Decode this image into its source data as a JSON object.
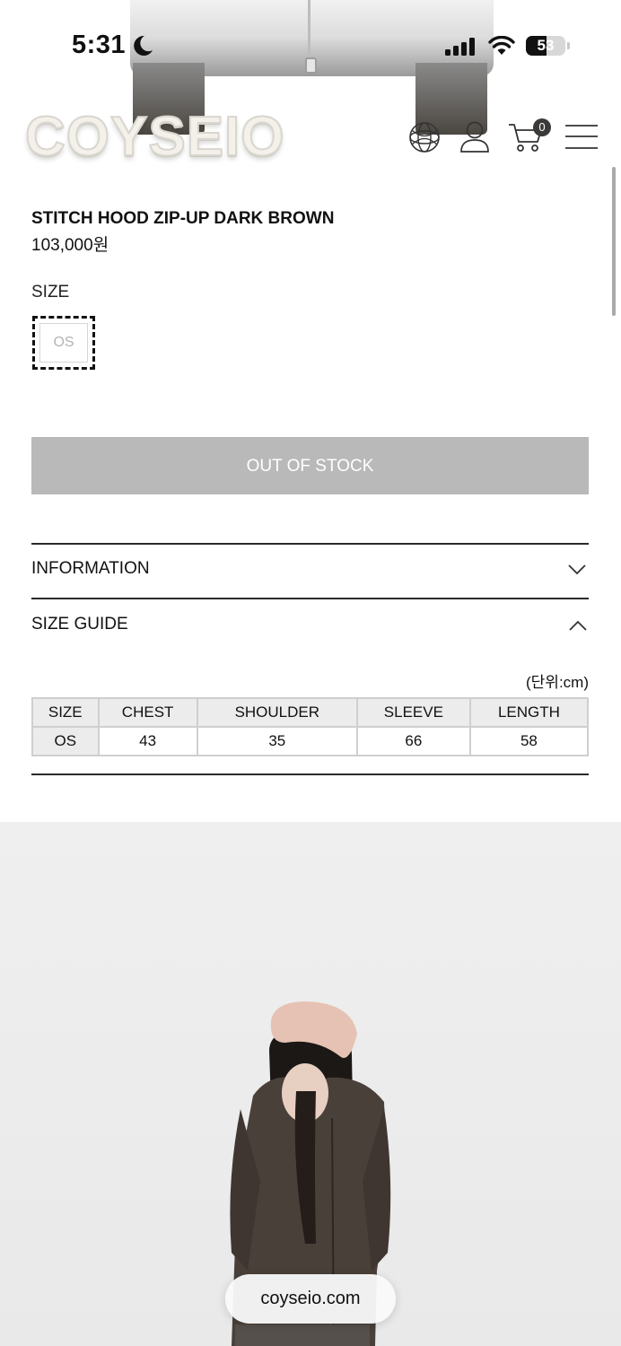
{
  "status_bar": {
    "time": "5:31",
    "battery": "53",
    "battery_level": 0.53,
    "icons": [
      "moon-icon",
      "signal-icon",
      "wifi-icon",
      "battery-icon"
    ]
  },
  "header": {
    "logo": "COYSEIO",
    "cart_count": "0",
    "icons": [
      "globe-icon",
      "user-icon",
      "cart-icon",
      "menu-icon"
    ]
  },
  "product": {
    "name": "STITCH HOOD ZIP-UP DARK BROWN",
    "price": "103,000원",
    "size_label": "SIZE",
    "size_options": [
      "OS"
    ],
    "button_label": "OUT OF STOCK"
  },
  "accordion": [
    {
      "title": "INFORMATION",
      "expanded": false
    },
    {
      "title": "SIZE GUIDE",
      "expanded": true
    }
  ],
  "size_guide": {
    "unit": "(단위:cm)",
    "headers": [
      "SIZE",
      "CHEST",
      "SHOULDER",
      "SLEEVE",
      "LENGTH"
    ],
    "rows": [
      [
        "OS",
        "43",
        "35",
        "66",
        "58"
      ]
    ]
  },
  "browser": {
    "url": "coyseio.com"
  },
  "colors": {
    "button_bg": "#b9b9b9",
    "badge_bg": "#3b3a38",
    "table_header_bg": "#ececec"
  }
}
